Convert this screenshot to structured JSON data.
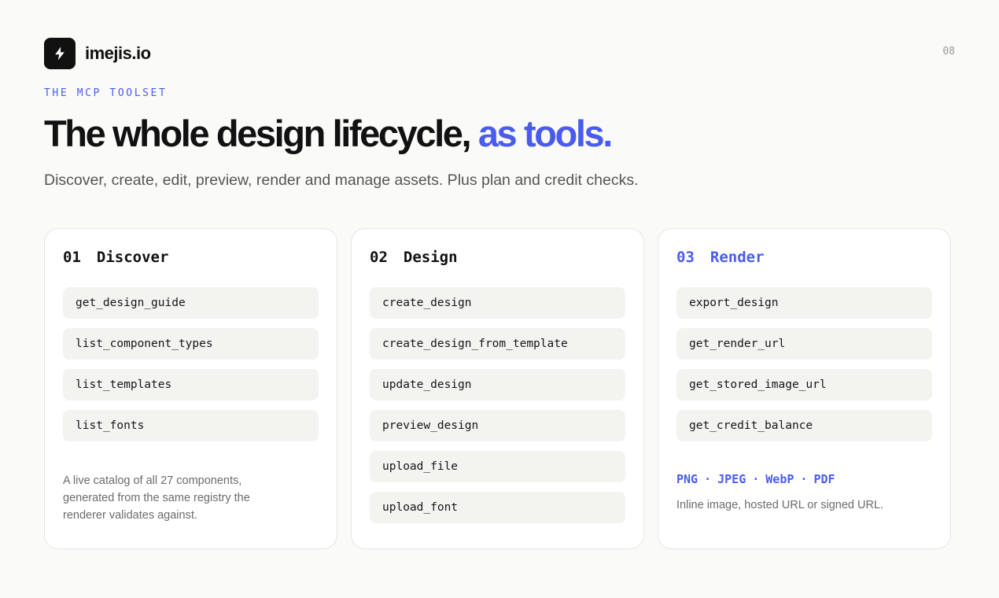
{
  "brand": {
    "name": "imejis.io",
    "icon": "lightning-bolt-icon"
  },
  "page_number": "08",
  "eyebrow": "THE MCP TOOLSET",
  "headline": {
    "main": "The whole design lifecycle, ",
    "accent": "as tools."
  },
  "subtitle": "Discover, create, edit, preview, render and manage assets. Plus plan and credit checks.",
  "colors": {
    "accent": "#4a5cf0",
    "ink": "#111111",
    "background": "#fafaf8",
    "chip": "#f3f3f0"
  },
  "cards": [
    {
      "number": "01",
      "title": "Discover",
      "tools": [
        "get_design_guide",
        "list_component_types",
        "list_templates",
        "list_fonts"
      ],
      "note": "A live catalog of all 27 components, generated from the same registry the renderer validates against."
    },
    {
      "number": "02",
      "title": "Design",
      "tools": [
        "create_design",
        "create_design_from_template",
        "update_design",
        "preview_design",
        "upload_file",
        "upload_font"
      ]
    },
    {
      "number": "03",
      "title": "Render",
      "tools": [
        "export_design",
        "get_render_url",
        "get_stored_image_url",
        "get_credit_balance"
      ],
      "formats": [
        "PNG",
        "JPEG",
        "WebP",
        "PDF"
      ],
      "format_separator": "·",
      "formats_note": "Inline image, hosted URL or signed URL."
    }
  ]
}
